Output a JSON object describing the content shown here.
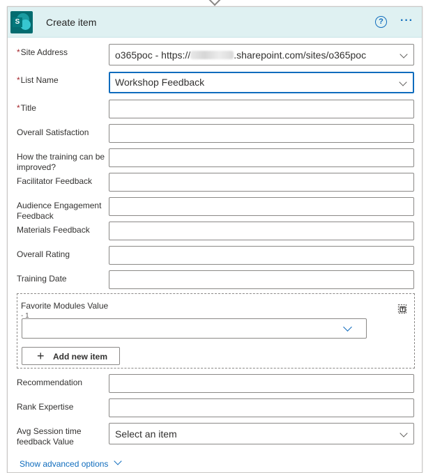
{
  "header": {
    "title": "Create item",
    "logo_letter": "S",
    "help_glyph": "?",
    "more_glyph": "···"
  },
  "fields": {
    "site_address": {
      "label": "Site Address",
      "value_prefix": "o365poc - https://",
      "value_suffix": ".sharepoint.com/sites/o365poc"
    },
    "list_name": {
      "label": "List Name",
      "value": "Workshop Feedback"
    },
    "title": {
      "label": "Title",
      "value": ""
    },
    "overall_satisfaction": {
      "label": "Overall Satisfaction",
      "value": ""
    },
    "training_improve": {
      "label": "How the training can be improved?",
      "value": ""
    },
    "facilitator_feedback": {
      "label": "Facilitator Feedback",
      "value": ""
    },
    "audience_engagement": {
      "label": "Audience Engagement Feedback",
      "value": ""
    },
    "materials_feedback": {
      "label": "Materials Feedback",
      "value": ""
    },
    "overall_rating": {
      "label": "Overall Rating",
      "value": ""
    },
    "training_date": {
      "label": "Training Date",
      "value": ""
    },
    "recommendation": {
      "label": "Recommendation",
      "value": ""
    },
    "rank_expertise": {
      "label": "Rank Expertise",
      "value": ""
    },
    "avg_session": {
      "label": "Avg Session time feedback Value",
      "placeholder": "Select an item"
    }
  },
  "required_marker": "*",
  "favorite_modules": {
    "label": "Favorite Modules Value",
    "index_label": "- 1",
    "add_button": "Add new item",
    "add_icon": "+"
  },
  "advanced": {
    "link": "Show advanced options"
  },
  "colors": {
    "header_bg": "#dff1f2",
    "accent": "#0f6cbd",
    "required": "#a4262c",
    "sharepoint_teal": "#036c70"
  },
  "icons": {
    "logo": "sharepoint-logo-icon",
    "help": "help-icon",
    "more": "more-options-icon",
    "switch_mode": "switch-to-array-input-icon",
    "dropdown": "chevron-down-icon"
  }
}
